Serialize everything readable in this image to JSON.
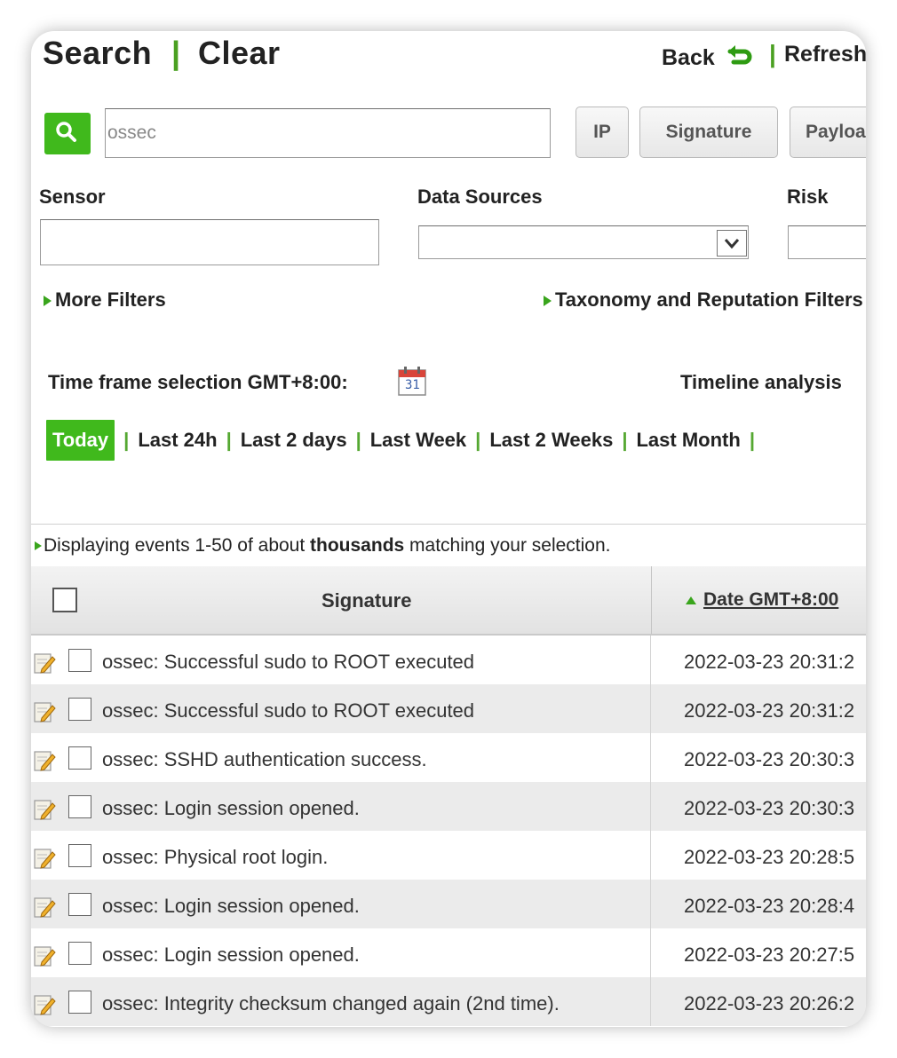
{
  "header": {
    "search_label": "Search",
    "separator": "|",
    "clear_label": "Clear",
    "back_label": "Back",
    "refresh_label": "Refresh"
  },
  "search": {
    "value": "ossec",
    "buttons": [
      "IP",
      "Signature",
      "Payload"
    ]
  },
  "filters": {
    "sensor_label": "Sensor",
    "sensor_value": "",
    "data_sources_label": "Data Sources",
    "data_sources_value": "",
    "risk_label": "Risk",
    "risk_value": "",
    "more_filters": "More Filters",
    "taxonomy_filters": "Taxonomy and Reputation Filters"
  },
  "timeframe": {
    "label": "Time frame selection GMT+8:00:",
    "calendar_day": "31",
    "timeline_label": "Timeline analysis",
    "options": [
      "Today",
      "Last 24h",
      "Last 2 days",
      "Last Week",
      "Last 2 Weeks",
      "Last Month"
    ],
    "active": "Today"
  },
  "results": {
    "prefix": "Displaying events 1-50 of about ",
    "count_word": "thousands",
    "suffix": " matching your selection."
  },
  "table": {
    "col_signature": "Signature",
    "col_date": "Date GMT+8:00",
    "rows": [
      {
        "signature": "ossec: Successful sudo to ROOT executed",
        "date": "2022-03-23 20:31:2"
      },
      {
        "signature": "ossec: Successful sudo to ROOT executed",
        "date": "2022-03-23 20:31:2"
      },
      {
        "signature": "ossec: SSHD authentication success.",
        "date": "2022-03-23 20:30:3"
      },
      {
        "signature": "ossec: Login session opened.",
        "date": "2022-03-23 20:30:3"
      },
      {
        "signature": "ossec: Physical root login.",
        "date": "2022-03-23 20:28:5"
      },
      {
        "signature": "ossec: Login session opened.",
        "date": "2022-03-23 20:28:4"
      },
      {
        "signature": "ossec: Login session opened.",
        "date": "2022-03-23 20:27:5"
      },
      {
        "signature": "ossec: Integrity checksum changed again (2nd time).",
        "date": "2022-03-23 20:26:2"
      }
    ]
  },
  "colors": {
    "accent_green": "#40b91c",
    "row_alt": "#ebebeb",
    "header_bg": "#e6e6e6"
  }
}
